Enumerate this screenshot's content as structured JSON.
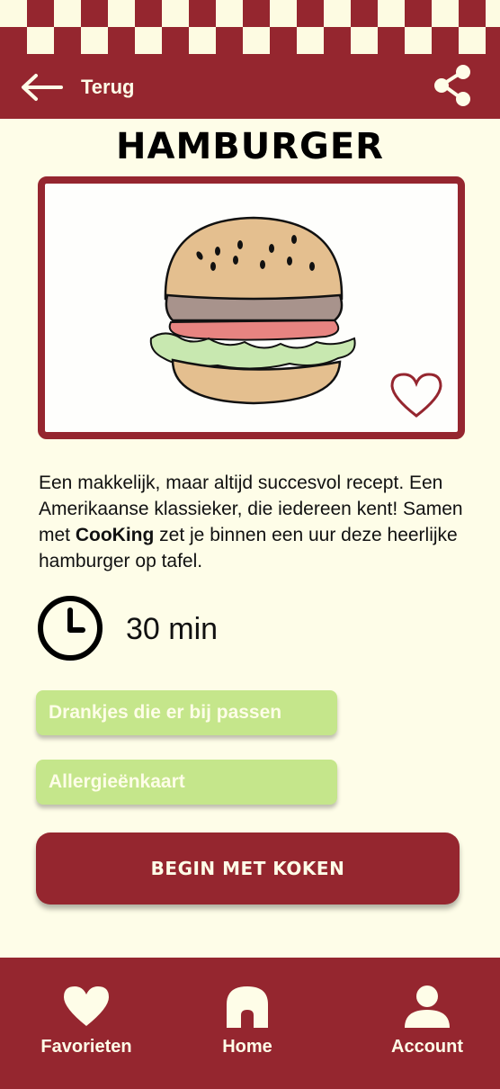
{
  "header": {
    "back_label": "Terug"
  },
  "recipe": {
    "title": "HAMBURGER",
    "description_part1": "Een makkelijk, maar altijd succesvol recept. Een Amerikaanse klassieker, die iedereen kent! Samen met ",
    "brand": "CooKing",
    "description_part2": " zet je binnen een uur deze heerlijke hamburger op tafel.",
    "time": "30 min"
  },
  "buttons": {
    "drinks": "Drankjes die er bij passen",
    "allergens": "Allergieënkaart",
    "start": "BEGIN MET KOKEN"
  },
  "nav": {
    "favorites": "Favorieten",
    "home": "Home",
    "account": "Account"
  },
  "colors": {
    "primary": "#95262f",
    "background": "#fefde8",
    "pill": "#c5e68b"
  },
  "icons": {
    "back": "arrow-left-icon",
    "share": "share-icon",
    "favorite": "heart-outline-icon",
    "time": "clock-icon",
    "nav_favorites": "heart-icon",
    "nav_home": "house-icon",
    "nav_account": "person-icon"
  }
}
